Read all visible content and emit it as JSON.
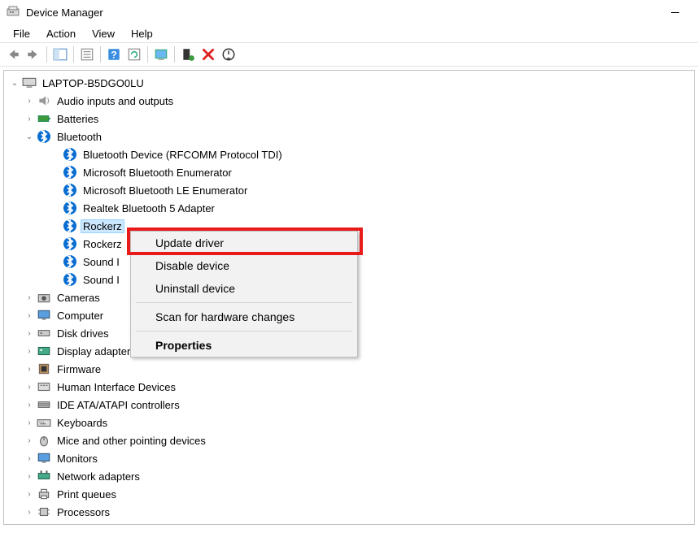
{
  "window": {
    "title": "Device Manager"
  },
  "menubar": {
    "file": "File",
    "action": "Action",
    "view": "View",
    "help": "Help"
  },
  "tree": {
    "root": "LAPTOP-B5DGO0LU",
    "audio": "Audio inputs and outputs",
    "batteries": "Batteries",
    "bluetooth": "Bluetooth",
    "bt_items": {
      "rfcomm": "Bluetooth Device (RFCOMM Protocol TDI)",
      "msenum": "Microsoft Bluetooth Enumerator",
      "msleenum": "Microsoft Bluetooth LE Enumerator",
      "realtek": "Realtek Bluetooth 5 Adapter",
      "rockerz1": "Rockerz",
      "rockerz2": "Rockerz",
      "sound1": "Sound I",
      "sound2": "Sound I"
    },
    "cameras": "Cameras",
    "computer": "Computer",
    "disk": "Disk drives",
    "display": "Display adapters",
    "firmware": "Firmware",
    "hid": "Human Interface Devices",
    "ide": "IDE ATA/ATAPI controllers",
    "keyboards": "Keyboards",
    "mice": "Mice and other pointing devices",
    "monitors": "Monitors",
    "network": "Network adapters",
    "print": "Print queues",
    "processors": "Processors"
  },
  "context_menu": {
    "update": "Update driver",
    "disable": "Disable device",
    "uninstall": "Uninstall device",
    "scan": "Scan for hardware changes",
    "properties": "Properties"
  }
}
